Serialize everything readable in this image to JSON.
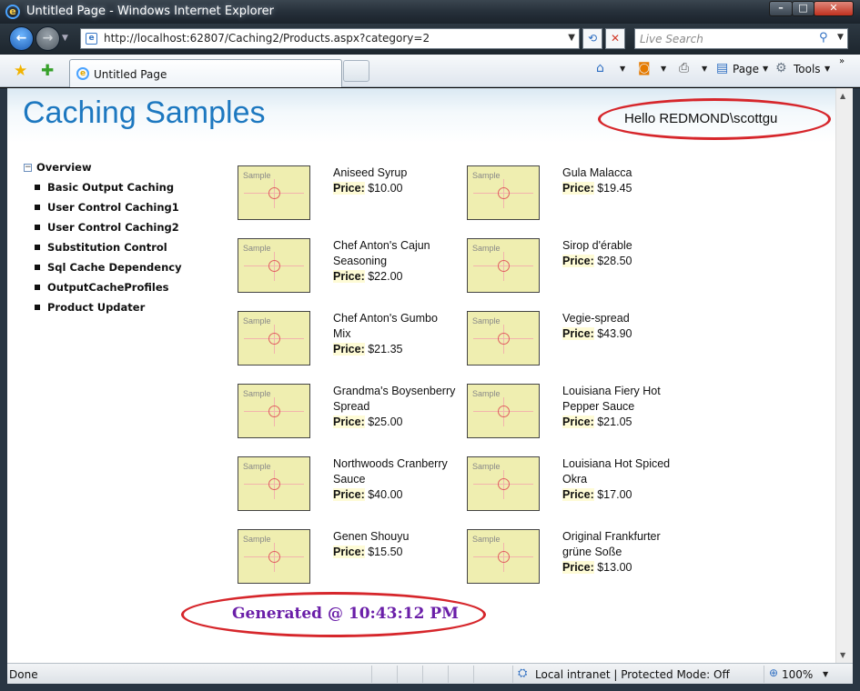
{
  "window": {
    "title": "Untitled Page - Windows Internet Explorer",
    "controls": {
      "minimize": "–",
      "maximize": "□",
      "close": "✕"
    }
  },
  "address_bar": {
    "url": "http://localhost:62807/Caching2/Products.aspx?category=2",
    "search_placeholder": "Live Search"
  },
  "tabs": [
    {
      "label": "Untitled Page"
    }
  ],
  "command_bar": {
    "page_label": "Page",
    "tools_label": "Tools"
  },
  "icons": {
    "back": "back-arrow-icon",
    "forward": "forward-arrow-icon",
    "refresh": "refresh-icon",
    "stop": "stop-icon",
    "search": "search-icon",
    "favorites": "favorites-star-icon",
    "add_favorites": "add-favorites-icon",
    "home": "home-icon",
    "feeds": "rss-feed-icon",
    "print": "printer-icon",
    "page": "page-icon",
    "tools": "gear-icon",
    "zone": "local-intranet-icon",
    "zoom": "zoom-icon"
  },
  "page": {
    "title": "Caching Samples",
    "greeting": "Hello REDMOND\\scottgu",
    "nav": {
      "root": "Overview",
      "toggle": "−",
      "items": [
        "Basic Output Caching",
        "User Control Caching1",
        "User Control Caching2",
        "Substitution Control",
        "Sql Cache Dependency",
        "OutputCacheProfiles",
        "Product Updater"
      ]
    },
    "thumbnail_label": "Sample",
    "price_label": "Price:",
    "products": [
      {
        "name": "Aniseed Syrup",
        "price": "$10.00"
      },
      {
        "name": "Gula Malacca",
        "price": "$19.45"
      },
      {
        "name": "Chef Anton's Cajun Seasoning",
        "price": "$22.00"
      },
      {
        "name": "Sirop d'érable",
        "price": "$28.50"
      },
      {
        "name": "Chef Anton's Gumbo Mix",
        "price": "$21.35"
      },
      {
        "name": "Vegie-spread",
        "price": "$43.90"
      },
      {
        "name": "Grandma's Boysenberry Spread",
        "price": "$25.00"
      },
      {
        "name": "Louisiana Fiery Hot Pepper Sauce",
        "price": "$21.05"
      },
      {
        "name": "Northwoods Cranberry Sauce",
        "price": "$40.00"
      },
      {
        "name": "Louisiana Hot Spiced Okra",
        "price": "$17.00"
      },
      {
        "name": "Genen Shouyu",
        "price": "$15.50"
      },
      {
        "name": "Original Frankfurter grüne Soße",
        "price": "$13.00"
      }
    ],
    "generated": "Generated @ 10:43:12 PM"
  },
  "status_bar": {
    "status": "Done",
    "zone": "Local intranet | Protected Mode: Off",
    "zoom": "100%"
  },
  "colors": {
    "title_blue": "#1d78c0",
    "annotation_red": "#d6262b",
    "generated_purple": "#6a1ea8",
    "thumbnail_fill": "#efeeb0"
  }
}
